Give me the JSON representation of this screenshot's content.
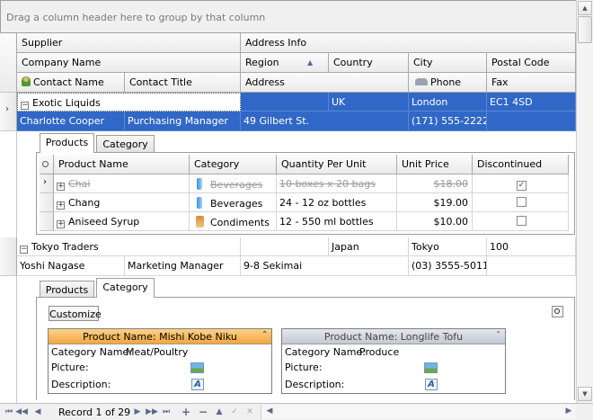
{
  "group_panel": {
    "hint": "Drag a column header here to group by that column"
  },
  "band_headers": {
    "supplier": "Supplier",
    "address_info": "Address Info"
  },
  "column_headers": {
    "company_name": "Company Name",
    "region": "Region",
    "country": "Country",
    "city": "City",
    "postal_code": "Postal Code",
    "contact_name": "Contact Name",
    "contact_title": "Contact Title",
    "address": "Address",
    "phone": "Phone",
    "fax": "Fax"
  },
  "suppliers": [
    {
      "company_name": "Exotic Liquids",
      "region": "",
      "country": "UK",
      "city": "London",
      "postal_code": "EC1 4SD",
      "contact_name": "Charlotte Cooper",
      "contact_title": "Purchasing Manager",
      "address": "49 Gilbert St.",
      "phone": "(171) 555-2222",
      "fax": ""
    },
    {
      "company_name": "Tokyo Traders",
      "region": "",
      "country": "Japan",
      "city": "Tokyo",
      "postal_code": "100",
      "contact_name": "Yoshi Nagase",
      "contact_title": "Marketing Manager",
      "address": "9-8 Sekimai",
      "phone": "(03) 3555-5011",
      "fax": ""
    }
  ],
  "detail_tabs": {
    "products": "Products",
    "category": "Category"
  },
  "products_grid": {
    "headers": {
      "product_name": "Product Name",
      "category": "Category",
      "quantity": "Quantity Per Unit",
      "price": "Unit Price",
      "discontinued": "Discontinued"
    },
    "rows": [
      {
        "product_name": "Chai",
        "category": "Beverages",
        "quantity": "10 boxes x 20 bags",
        "price": "$18.00",
        "discontinued": true
      },
      {
        "product_name": "Chang",
        "category": "Beverages",
        "quantity": "24 - 12 oz bottles",
        "price": "$19.00",
        "discontinued": false
      },
      {
        "product_name": "Aniseed Syrup",
        "category": "Condiments",
        "quantity": "12 - 550 ml bottles",
        "price": "$10.00",
        "discontinued": false
      }
    ]
  },
  "category_view": {
    "customize_label": "Customize",
    "cards": [
      {
        "header": "Product Name: Mishi Kobe Niku",
        "category_label": "Category Name:",
        "category_value": "Meat/Poultry",
        "picture_label": "Picture:",
        "description_label": "Description:"
      },
      {
        "header": "Product Name: Longlife Tofu",
        "category_label": "Category Name:",
        "category_value": "Produce",
        "picture_label": "Picture:",
        "description_label": "Description:"
      }
    ]
  },
  "navigator": {
    "record_text": "Record 1 of 29"
  },
  "colors": {
    "selection": "#3168c7",
    "active_card_header": "#f8b84c",
    "card_header": "#cfd3dc"
  }
}
